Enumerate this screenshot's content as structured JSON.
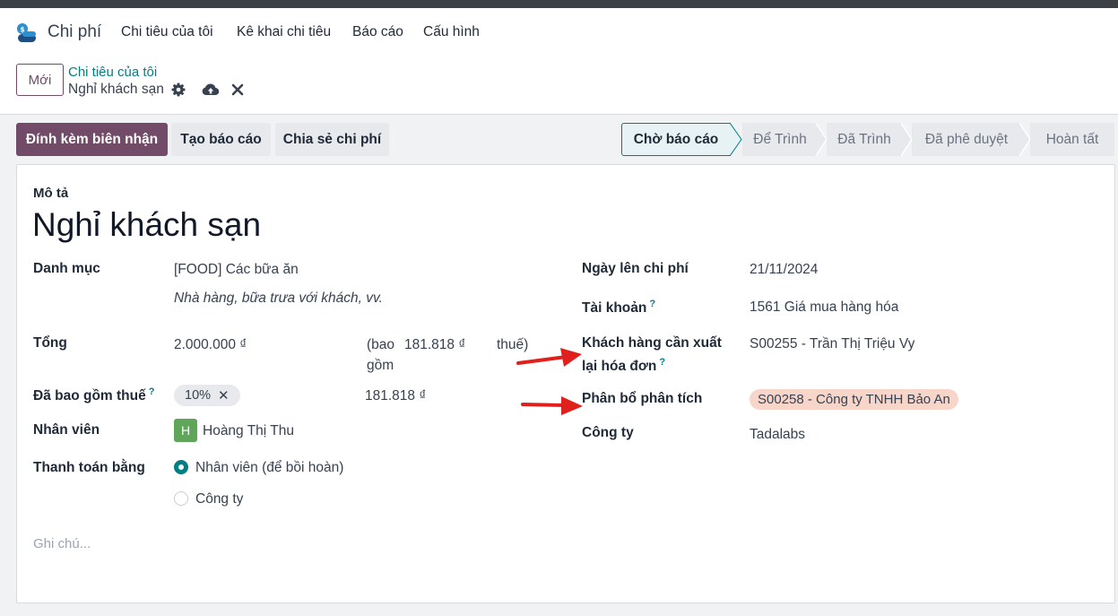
{
  "navbar": {
    "app_name": "Chi phí",
    "menu": [
      "Chi tiêu của tôi",
      "Kê khai chi tiêu",
      "Báo cáo",
      "Cấu hình"
    ]
  },
  "control": {
    "new_label": "Mới",
    "breadcrumb_parent": "Chi tiêu của tôi",
    "breadcrumb_current": "Nghỉ khách sạn"
  },
  "actions": {
    "attach_receipt": "Đính kèm biên nhận",
    "create_report": "Tạo báo cáo",
    "split_expense": "Chia sẻ chi phí"
  },
  "status": {
    "current": "Chờ báo cáo",
    "steps": [
      "Để Trình",
      "Đã Trình",
      "Đã phê duyệt",
      "Hoàn tất"
    ]
  },
  "form": {
    "description_label": "Mô tả",
    "title": "Nghỉ khách sạn",
    "category_label": "Danh mục",
    "category_value": "[FOOD] Các bữa ăn",
    "category_note": "Nhà hàng, bữa trưa với khách, vv.",
    "total_label": "Tổng",
    "total_value": "2.000.000 ₫",
    "tax_incl_open": "(bao",
    "tax_incl_amount": "181.818 ₫",
    "tax_incl_close": "thuế)",
    "tax_incl_wrap": "gồm",
    "tax_label": "Đã bao gồm thuế",
    "tax_tag": "10%",
    "tax_amount": "181.818 ₫",
    "employee_label": "Nhân viên",
    "employee_initial": "H",
    "employee_name": "Hoàng Thị Thu",
    "paid_by_label": "Thanh toán bằng",
    "paid_by_options": [
      "Nhân viên (để bồi hoàn)",
      "Công ty"
    ],
    "notes_placeholder": "Ghi chú...",
    "date_label": "Ngày lên chi phí",
    "date_value": "21/11/2024",
    "account_label": "Tài khoản",
    "account_value": "1561 Giá mua hàng hóa",
    "reinvoice_label_1": "Khách hàng cần xuất",
    "reinvoice_label_2": "lại hóa đơn",
    "reinvoice_value": "S00255 - Trần Thị Triệu Vy",
    "analytic_label": "Phân bổ phân tích",
    "analytic_tag": "S00258 - Công ty TNHH Bảo An",
    "company_label": "Công ty",
    "company_value": "Tadalabs",
    "tooltip_mark": "?"
  },
  "colors": {
    "brand": "#714b67",
    "accent": "#017e84",
    "annotation_arrow": "#e0201d",
    "analytic_tag_bg": "#f8d5c9"
  }
}
